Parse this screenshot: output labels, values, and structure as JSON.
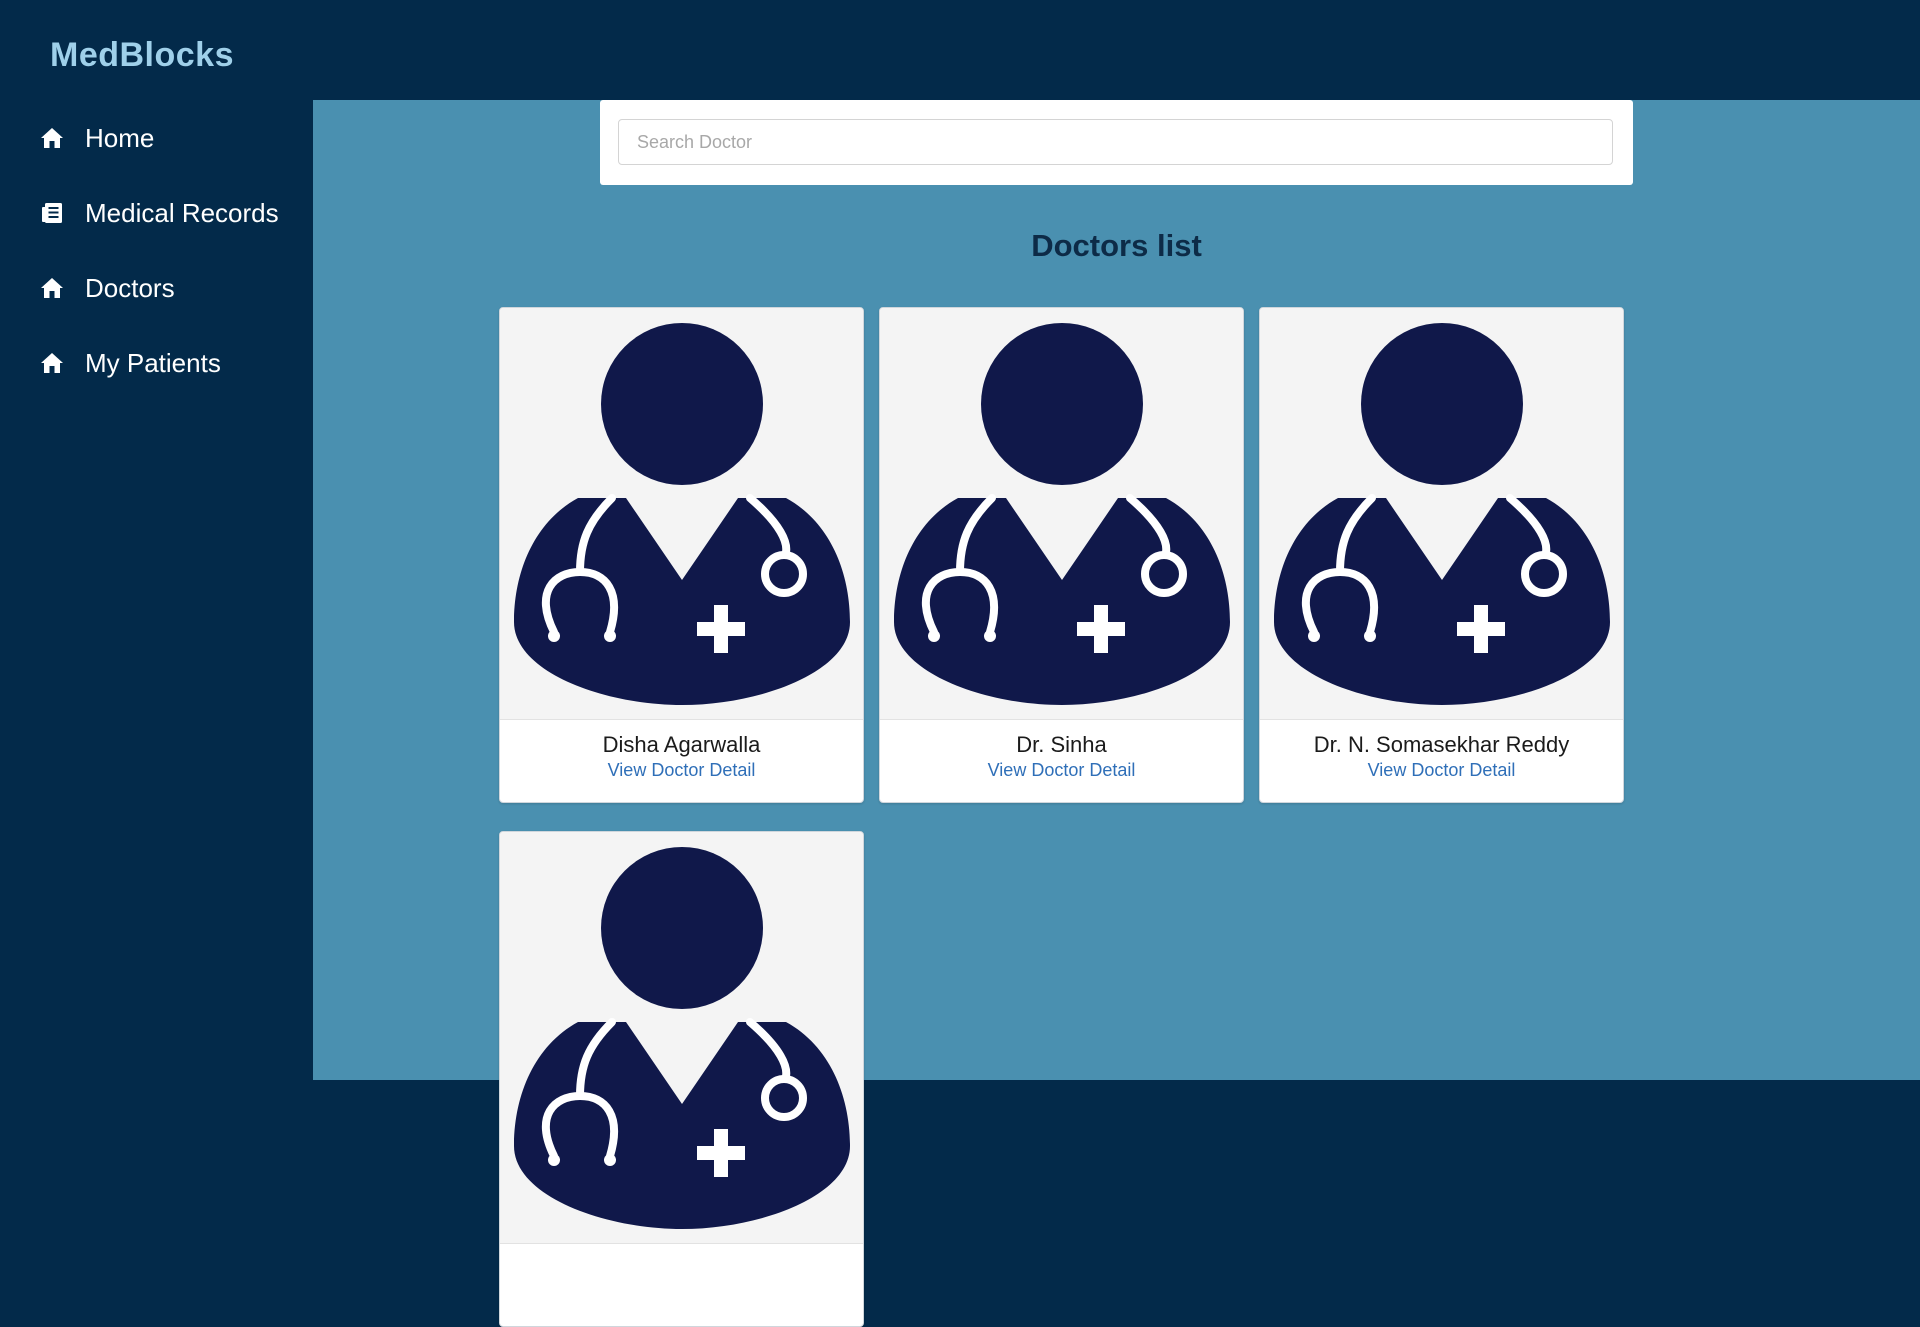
{
  "app": {
    "brand": "MedBlocks"
  },
  "sidebar": {
    "items": [
      {
        "label": "Home",
        "icon": "home-icon"
      },
      {
        "label": "Medical Records",
        "icon": "records-icon"
      },
      {
        "label": "Doctors",
        "icon": "home-icon"
      },
      {
        "label": "My Patients",
        "icon": "home-icon"
      }
    ]
  },
  "search": {
    "placeholder": "Search Doctor",
    "value": ""
  },
  "main": {
    "title": "Doctors list",
    "doctors": [
      {
        "name": "Disha Agarwalla",
        "link": "View Doctor Detail",
        "icon": "doctor-avatar-icon"
      },
      {
        "name": "Dr. Sinha",
        "link": "View Doctor Detail",
        "icon": "doctor-avatar-icon"
      },
      {
        "name": "Dr. N. Somasekhar Reddy",
        "link": "View Doctor Detail",
        "icon": "doctor-avatar-icon"
      },
      {
        "name": "",
        "link": "",
        "icon": "doctor-avatar-icon"
      }
    ]
  },
  "colors": {
    "sidebar_bg": "#032a4a",
    "main_bg": "#4a90b0",
    "brand": "#9fd0ea",
    "avatar": "#10184a",
    "link": "#2f6fb8"
  }
}
